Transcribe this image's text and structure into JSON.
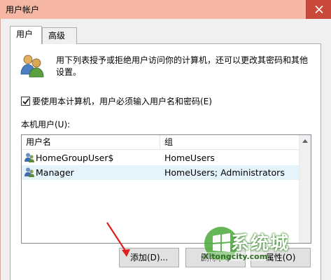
{
  "window": {
    "title": "用户帐户"
  },
  "tabs": [
    {
      "label": "用户"
    },
    {
      "label": "高级"
    }
  ],
  "description": "用下列表授予或拒绝用户访问你的计算机，还可以更改其密码和其他设置。",
  "require_login": {
    "label": "要使用本计算机，用户必须输入用户名和密码(E)",
    "checked": true
  },
  "users_section_label": "本机用户(U):",
  "table": {
    "columns": [
      "用户名",
      "组"
    ],
    "rows": [
      {
        "name": "HomeGroupUser$",
        "group": "HomeUsers"
      },
      {
        "name": "Manager",
        "group": "HomeUsers; Administrators"
      }
    ]
  },
  "buttons": {
    "add": "添加(D)...",
    "remove": "删除(R)",
    "properties": "属性(O)"
  },
  "watermark": {
    "brand": "系统城",
    "url": "Xitongcity.com"
  },
  "colors": {
    "titlebar": "#f6b7a4",
    "close": "#c94a3c",
    "selected_row": "#e5f3fb",
    "arrow": "#e02020"
  }
}
